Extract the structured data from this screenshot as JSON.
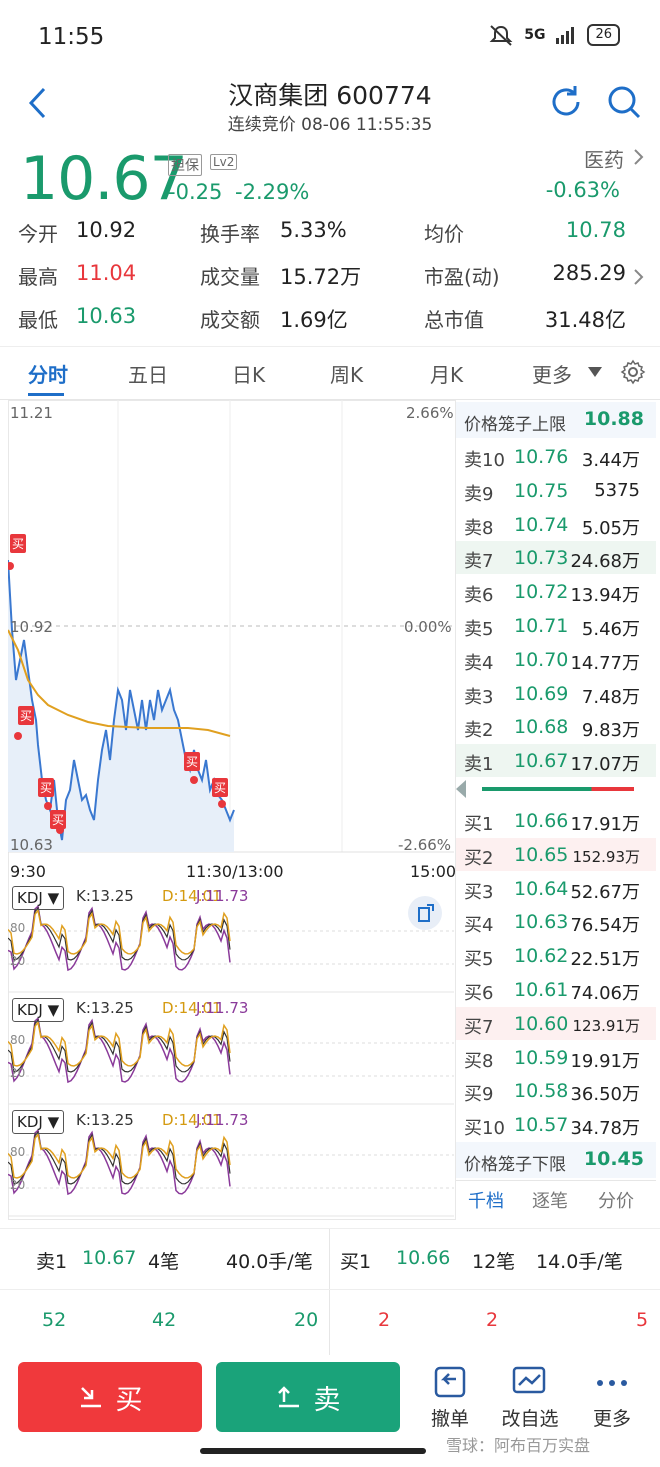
{
  "status_bar": {
    "time": "11:55",
    "network": "5G",
    "battery": "26"
  },
  "header": {
    "title": "汉商集团 600774",
    "subtitle": "连续竞价 08-06 11:55:35"
  },
  "quote": {
    "price": "10.67",
    "tag1": "担保",
    "tag2": "Lv2",
    "change": "-0.25",
    "change_pct": "-2.29%",
    "sector": "医药",
    "sector_change": "-0.63%",
    "stats": [
      {
        "label": "今开",
        "value": "10.92"
      },
      {
        "label": "换手率",
        "value": "5.33%"
      },
      {
        "label": "均价",
        "value": "10.78"
      },
      {
        "label": "最高",
        "value": "11.04"
      },
      {
        "label": "成交量",
        "value": "15.72万"
      },
      {
        "label": "市盈(动)",
        "value": "285.29"
      },
      {
        "label": "最低",
        "value": "10.63"
      },
      {
        "label": "成交额",
        "value": "1.69亿"
      },
      {
        "label": "总市值",
        "value": "31.48亿"
      }
    ]
  },
  "tabs": [
    "分时",
    "五日",
    "日K",
    "周K",
    "月K",
    "更多"
  ],
  "chart": {
    "price_high": "11.21",
    "price_mid": "10.92",
    "price_low": "10.63",
    "pct_high": "2.66%",
    "pct_mid": "0.00%",
    "pct_low": "-2.66%",
    "time_start": "9:30",
    "time_mid": "11:30/13:00",
    "time_end": "15:00",
    "buy_marker": "买",
    "indicators": [
      {
        "name": "KDJ",
        "k": "K:13.25",
        "d": "D:14.01",
        "j": "J:11.73",
        "tick1": "80",
        "tick2": "20"
      },
      {
        "name": "KDJ",
        "k": "K:13.25",
        "d": "D:14.01",
        "j": "J:11.73",
        "tick1": "80",
        "tick2": "20"
      },
      {
        "name": "KDJ",
        "k": "K:13.25",
        "d": "D:14.01",
        "j": "J:11.73",
        "tick1": "80",
        "tick2": "20"
      }
    ],
    "colors": {
      "price_line": "#3a78d0",
      "avg_line": "#e0a020",
      "k_line": "#333333",
      "d_line": "#e0a020",
      "j_line": "#8a3a9a"
    }
  },
  "order_book": {
    "upper_limit_label": "价格笼子上限",
    "upper_limit": "10.88",
    "lower_limit_label": "价格笼子下限",
    "lower_limit": "10.45",
    "asks": [
      {
        "label": "卖10",
        "price": "10.76",
        "vol": "3.44万"
      },
      {
        "label": "卖9",
        "price": "10.75",
        "vol": "5375"
      },
      {
        "label": "卖8",
        "price": "10.74",
        "vol": "5.05万"
      },
      {
        "label": "卖7",
        "price": "10.73",
        "vol": "24.68万"
      },
      {
        "label": "卖6",
        "price": "10.72",
        "vol": "13.94万"
      },
      {
        "label": "卖5",
        "price": "10.71",
        "vol": "5.46万"
      },
      {
        "label": "卖4",
        "price": "10.70",
        "vol": "14.77万"
      },
      {
        "label": "卖3",
        "price": "10.69",
        "vol": "7.48万"
      },
      {
        "label": "卖2",
        "price": "10.68",
        "vol": "9.83万"
      },
      {
        "label": "卖1",
        "price": "10.67",
        "vol": "17.07万"
      }
    ],
    "bids": [
      {
        "label": "买1",
        "price": "10.66",
        "vol": "17.91万"
      },
      {
        "label": "买2",
        "price": "10.65",
        "vol": "152.93万"
      },
      {
        "label": "买3",
        "price": "10.64",
        "vol": "52.67万"
      },
      {
        "label": "买4",
        "price": "10.63",
        "vol": "76.54万"
      },
      {
        "label": "买5",
        "price": "10.62",
        "vol": "22.51万"
      },
      {
        "label": "买6",
        "price": "10.61",
        "vol": "74.06万"
      },
      {
        "label": "买7",
        "price": "10.60",
        "vol": "123.91万"
      },
      {
        "label": "买8",
        "price": "10.59",
        "vol": "19.91万"
      },
      {
        "label": "买9",
        "price": "10.58",
        "vol": "36.50万"
      },
      {
        "label": "买10",
        "price": "10.57",
        "vol": "34.78万"
      }
    ],
    "tabs": [
      "千档",
      "逐笔",
      "分价"
    ]
  },
  "level_summary": {
    "sell": {
      "label": "卖1",
      "price": "10.67",
      "count": "4笔",
      "avg": "40.0手/笔"
    },
    "buy": {
      "label": "买1",
      "price": "10.66",
      "count": "12笔",
      "avg": "14.0手/笔"
    },
    "sell_orders": [
      "52",
      "42",
      "20"
    ],
    "buy_orders": [
      "2",
      "2",
      "5"
    ]
  },
  "bottom_bar": {
    "buy_label": "买",
    "sell_label": "卖",
    "tools": [
      "撤单",
      "改自选",
      "更多"
    ],
    "watermark": "雪球：阿布百万实盘"
  }
}
